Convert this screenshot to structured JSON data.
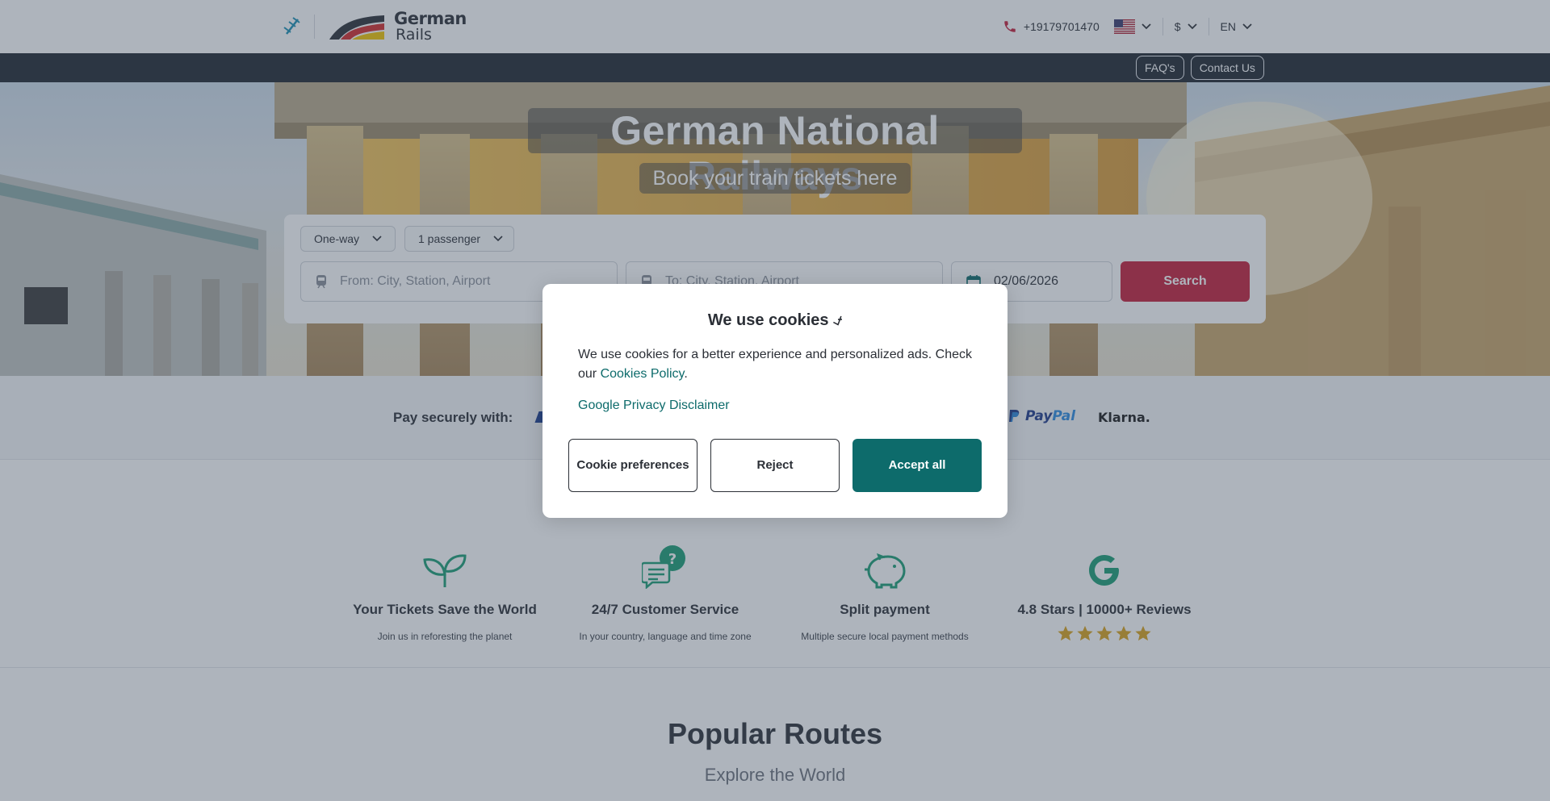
{
  "header": {
    "brand_line1": "German",
    "brand_line2": "Rails",
    "phone": "+19179701470",
    "currency": "$",
    "language": "EN"
  },
  "topbar": {
    "faq": "FAQ's",
    "contact": "Contact Us"
  },
  "hero": {
    "title": "German National Railways",
    "subtitle": "Book your train tickets here"
  },
  "search": {
    "trip_type": "One-way",
    "passengers": "1 passenger",
    "from_placeholder": "From: City, Station, Airport",
    "to_placeholder": "To: City, Station, Airport",
    "date": "02/06/2026",
    "search_label": "Search"
  },
  "payment": {
    "label": "Pay securely with:",
    "paypal_a": "Pay",
    "paypal_b": "Pal",
    "klarna": "Klarna."
  },
  "features": [
    {
      "title": "Your Tickets Save the World",
      "text": "Join us in reforesting the planet"
    },
    {
      "title": "24/7 Customer Service",
      "text": "In your country, language and time zone"
    },
    {
      "title": "Split payment",
      "text": "Multiple secure local payment methods"
    },
    {
      "title": "4.8 Stars | 10000+ Reviews",
      "rating": 5
    }
  ],
  "popular": {
    "title": "Popular Routes",
    "subtitle": "Explore the World"
  },
  "cookie_modal": {
    "title": "We use cookies ⍻",
    "body_prefix": "We use cookies for a better experience and personalized ads. Check our ",
    "policy_link": "Cookies Policy",
    "body_suffix": ".",
    "disclaimer": "Google Privacy Disclaimer",
    "prefs_button": "Cookie preferences",
    "reject_button": "Reject",
    "accept_button": "Accept all"
  },
  "colors": {
    "accent_teal": "#0d6b6b",
    "search_red": "#c41e3a",
    "feature_green": "#1a9e74",
    "star_gold": "#d9a21b"
  },
  "icons": {
    "logo": "train-track-icon",
    "phone": "phone-icon",
    "flag": "us-flag-icon",
    "features": [
      "leaf-sprout-icon",
      "chat-question-icon",
      "piggy-bank-icon",
      "google-g-icon"
    ]
  }
}
